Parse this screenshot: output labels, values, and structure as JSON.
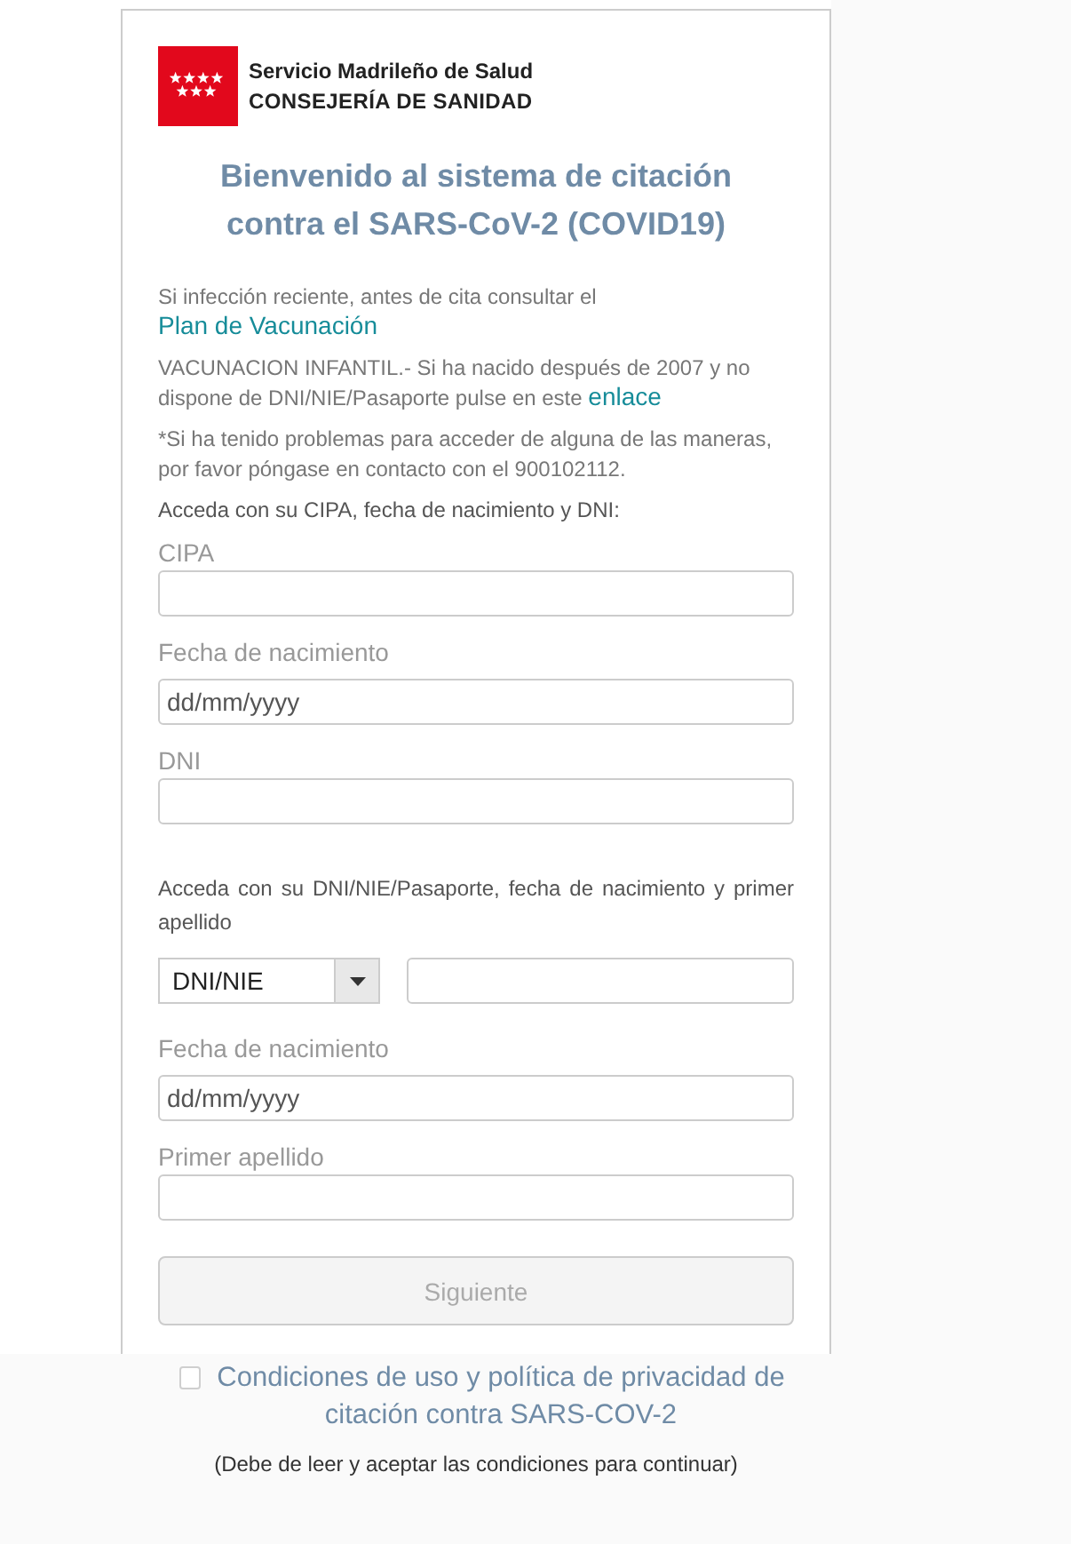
{
  "header": {
    "organization": "Servicio Madrileño de Salud",
    "department": "CONSEJERÍA DE SANIDAD"
  },
  "title": "Bienvenido al sistema de citación contra el SARS-CoV-2 (COVID19)",
  "notices": [
    {
      "text": "Si infección reciente, antes de cita consultar el ",
      "link": "Plan de Vacunación"
    },
    {
      "text": "VACUNACION INFANTIL.- Si ha nacido después de 2007 y no dispone de DNI/NIE/Pasaporte pulse en este ",
      "link": "enlace"
    },
    {
      "text": "*Si ha tenido problemas para acceder de alguna de las maneras, por favor póngase en contacto con el 900102112."
    }
  ],
  "cipa_form": {
    "intro": "Acceda con su CIPA, fecha de nacimiento y DNI:",
    "fields": [
      {
        "kind": "text",
        "label": "CIPA"
      },
      {
        "kind": "date",
        "label": "Fecha de nacimiento",
        "placeholder": "dd/mm/yyyy"
      },
      {
        "kind": "text",
        "label": "DNI"
      }
    ]
  },
  "document_form": {
    "intro": "Acceda con su DNI/NIE/Pasaporte, fecha de nacimiento y primer apellido",
    "document_type": {
      "value": "DNI/NIE"
    },
    "fields": [
      {
        "kind": "date",
        "label": "Fecha de nacimiento",
        "placeholder": "dd/mm/yyyy"
      },
      {
        "kind": "text",
        "label": "Primer apellido"
      }
    ]
  },
  "submit": {
    "label": "Siguiente",
    "disabled": true
  },
  "terms": {
    "checked": false,
    "label": "Condiciones de uso y política de privacidad de citación contra SARS-COV-2",
    "note": "(Debe de leer y aceptar las condiciones para continuar)"
  }
}
